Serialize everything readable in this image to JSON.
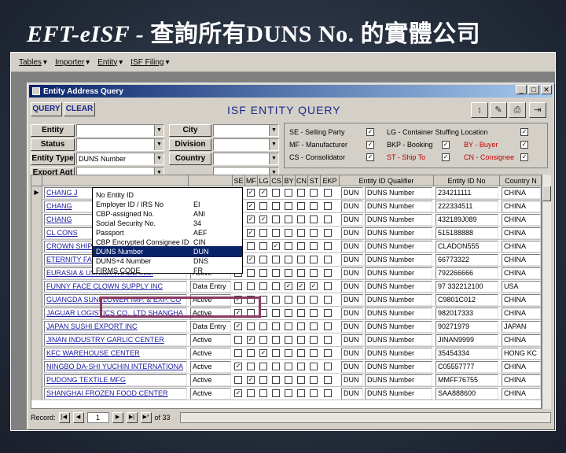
{
  "slide_title_latin": "EFT-eISF -",
  "slide_title_cjk": "查詢所有",
  "slide_title_duns": "DUNS No.",
  "slide_title_tail": "的實體公司",
  "menubar": {
    "items": [
      "Tables",
      "Importer",
      "Entity",
      "ISF Filing"
    ]
  },
  "window": {
    "title": "Entity Address Query",
    "min": "_",
    "max": "□",
    "close": "✕"
  },
  "toolbar": {
    "query_label": "QUERY",
    "clear_label": "CLEAR",
    "form_title": "ISF ENTITY QUERY"
  },
  "filters": {
    "entity_label": "Entity",
    "entity_value": "",
    "status_label": "Status",
    "status_value": "",
    "entity_type_label": "Entity Type",
    "entity_type_value": "DUNS Number",
    "export_agt_label": "Export Agt",
    "export_agt_value": "",
    "city_label": "City",
    "division_label": "Division",
    "country_label": "Country"
  },
  "legend": {
    "se": "SE - Selling Party",
    "mf": "MF - Manufacturer",
    "cs": "CS - Consolidator",
    "lg": "LG - Container Stuffing Location",
    "bkp": "BKP - Booking",
    "st": "ST - Ship To",
    "by": "BY - Buyer",
    "cn": "CN - Consignee"
  },
  "dropdown": [
    {
      "name": "No Entity ID",
      "code": ""
    },
    {
      "name": "Employer ID / IRS No",
      "code": "EI"
    },
    {
      "name": "CBP-assigned No.",
      "code": "ANI"
    },
    {
      "name": "Social Security No.",
      "code": "34"
    },
    {
      "name": "Passport",
      "code": "AEF"
    },
    {
      "name": "CBP Encrypted Consignee ID",
      "code": "CIN"
    },
    {
      "name": "DUNS Number",
      "code": "DUN"
    },
    {
      "name": "DUNS+4 Number",
      "code": "DNS"
    },
    {
      "name": "FIRMS CODE",
      "code": "FR"
    }
  ],
  "grid": {
    "headers": [
      "SE",
      "MF",
      "LG",
      "CS",
      "BY",
      "CN",
      "ST",
      "EKP",
      "Entity ID Qualifier",
      "Entity ID No",
      "Country N"
    ],
    "rows": [
      {
        "name": "CHANG J",
        "status": "",
        "qual": "DUN",
        "qname": "DUNS Number",
        "id": "234211111",
        "country": "CHINA"
      },
      {
        "name": "CHANG",
        "status": "",
        "qual": "DUN",
        "qname": "DUNS Number",
        "id": "222334511",
        "country": "CHINA"
      },
      {
        "name": "CHANG",
        "status": "",
        "qual": "DUN",
        "qname": "DUNS Number",
        "id": "432189J089",
        "country": "CHINA"
      },
      {
        "name": "CL CONS",
        "status": "",
        "qual": "DUN",
        "qname": "DUNS Number",
        "id": "515188888",
        "country": "CHINA"
      },
      {
        "name": "CROWN SHIPPING CENTER",
        "status": "Active",
        "qual": "DUN",
        "qname": "DUNS Number",
        "id": "CLADON555",
        "country": "CHINA"
      },
      {
        "name": "ETERNITY FACTORY INC.",
        "status": "Active",
        "qual": "DUN",
        "qname": "DUNS Number",
        "id": "66773322",
        "country": "CHINA"
      },
      {
        "name": "EURASIA & USASIA TRADE INC.",
        "status": "Active",
        "qual": "DUN",
        "qname": "DUNS Number",
        "id": "792266666",
        "country": "CHINA"
      },
      {
        "name": "FUNNY FACE CLOWN SUPPLY INC",
        "status": "Data Entry",
        "qual": "DUN",
        "qname": "DUNS Number",
        "id": "97 332212100",
        "country": "USA"
      },
      {
        "name": "GUANGDA SUNFLOWER IMP. & EXP. CO",
        "status": "Active",
        "qual": "DUN",
        "qname": "DUNS Number",
        "id": "C9801C012",
        "country": "CHINA"
      },
      {
        "name": "JAGUAR LOGISTICS CO., LTD SHANGHA",
        "status": "Active",
        "qual": "DUN",
        "qname": "DUNS Number",
        "id": "982017333",
        "country": "CHINA"
      },
      {
        "name": "JAPAN SUSHI EXPORT INC",
        "status": "Data Entry",
        "qual": "DUN",
        "qname": "DUNS Number",
        "id": "90271979",
        "country": "JAPAN"
      },
      {
        "name": "JINAN INDUSTRY GARLIC CENTER",
        "status": "Active",
        "qual": "DUN",
        "qname": "DUNS Number",
        "id": "JINAN9999",
        "country": "CHINA"
      },
      {
        "name": "KFC WAREHOUSE CENTER",
        "status": "Active",
        "qual": "DUN",
        "qname": "DUNS Number",
        "id": "35454334",
        "country": "HONG KC"
      },
      {
        "name": "NINGBO DA-SHI YUCHIN INTERNATIONA",
        "status": "Active",
        "qual": "DUN",
        "qname": "DUNS Number",
        "id": "C05557777",
        "country": "CHINA"
      },
      {
        "name": "PUDONG TEXTILE MFG",
        "status": "Active",
        "qual": "DUN",
        "qname": "DUNS Number",
        "id": "MMFF76755",
        "country": "CHINA"
      },
      {
        "name": "SHANGHAI FROZEN FOOD CENTER",
        "status": "Active",
        "qual": "DUN",
        "qname": "DUNS Number",
        "id": "SAA888600",
        "country": "CHINA"
      }
    ]
  },
  "navbar": {
    "record_label": "Record:",
    "current": "1",
    "of_label": "of 33"
  }
}
